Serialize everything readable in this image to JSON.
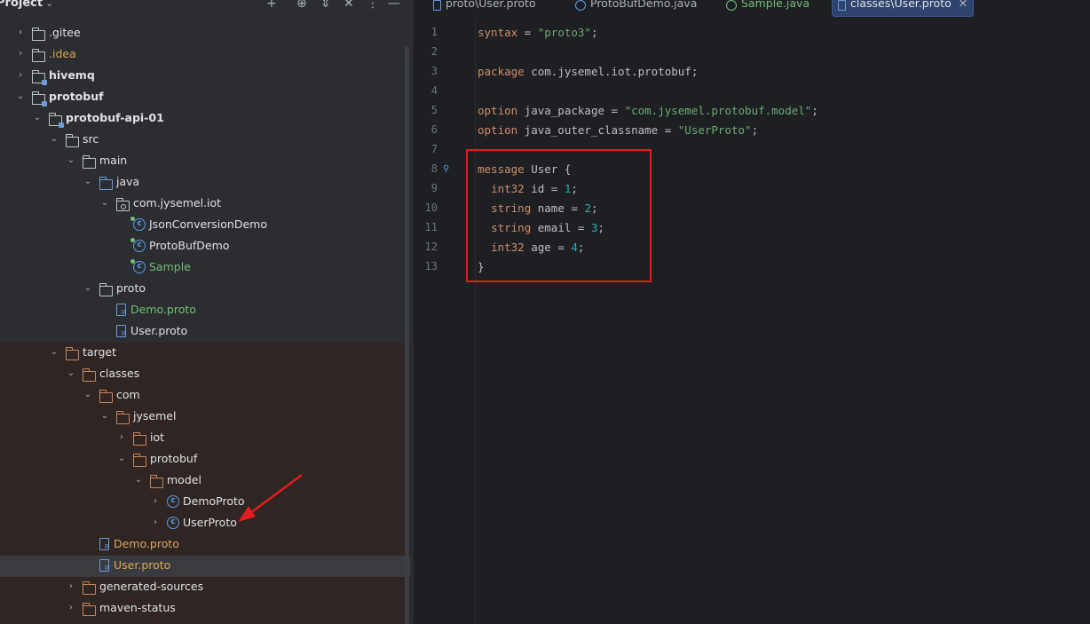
{
  "project_panel": {
    "title": "Project",
    "tree": [
      {
        "label": ".gitee",
        "arrow": "›",
        "icon": "folder",
        "style": ""
      },
      {
        "label": ".idea",
        "arrow": "›",
        "icon": "folder",
        "style": "orange"
      },
      {
        "label": "hivemq",
        "arrow": "›",
        "icon": "module-folder",
        "style": "bold"
      },
      {
        "label": "protobuf",
        "arrow": "⌄",
        "icon": "module-folder",
        "style": "bold"
      },
      {
        "label": "protobuf-api-01",
        "arrow": "⌄",
        "icon": "module-folder",
        "style": "bold"
      },
      {
        "label": "src",
        "arrow": "⌄",
        "icon": "folder",
        "style": ""
      },
      {
        "label": "main",
        "arrow": "⌄",
        "icon": "folder",
        "style": ""
      },
      {
        "label": "java",
        "arrow": "⌄",
        "icon": "folder-blue",
        "style": ""
      },
      {
        "label": "com.jysemel.iot",
        "arrow": "⌄",
        "icon": "package",
        "style": ""
      },
      {
        "label": "JsonConversionDemo",
        "arrow": "",
        "icon": "class-run",
        "style": ""
      },
      {
        "label": "ProtoBufDemo",
        "arrow": "",
        "icon": "class-run",
        "style": ""
      },
      {
        "label": "Sample",
        "arrow": "",
        "icon": "class-run",
        "style": "green"
      },
      {
        "label": "proto",
        "arrow": "⌄",
        "icon": "folder",
        "style": ""
      },
      {
        "label": "Demo.proto",
        "arrow": "",
        "icon": "proto-file",
        "style": "green"
      },
      {
        "label": "User.proto",
        "arrow": "",
        "icon": "proto-file",
        "style": ""
      },
      {
        "label": "target",
        "arrow": "⌄",
        "icon": "folder-orange",
        "style": ""
      },
      {
        "label": "classes",
        "arrow": "⌄",
        "icon": "folder-orange",
        "style": ""
      },
      {
        "label": "com",
        "arrow": "⌄",
        "icon": "folder-orange",
        "style": ""
      },
      {
        "label": "jysemel",
        "arrow": "⌄",
        "icon": "folder-orange",
        "style": ""
      },
      {
        "label": "iot",
        "arrow": "›",
        "icon": "folder-orange",
        "style": ""
      },
      {
        "label": "protobuf",
        "arrow": "⌄",
        "icon": "folder-orange",
        "style": ""
      },
      {
        "label": "model",
        "arrow": "⌄",
        "icon": "folder-orange",
        "style": ""
      },
      {
        "label": "DemoProto",
        "arrow": "›",
        "icon": "class",
        "style": ""
      },
      {
        "label": "UserProto",
        "arrow": "›",
        "icon": "class",
        "style": ""
      },
      {
        "label": "Demo.proto",
        "arrow": "",
        "icon": "proto-file",
        "style": "orange"
      },
      {
        "label": "User.proto",
        "arrow": "",
        "icon": "proto-file",
        "style": "orange"
      },
      {
        "label": "generated-sources",
        "arrow": "›",
        "icon": "folder-orange",
        "style": ""
      },
      {
        "label": "maven-status",
        "arrow": "›",
        "icon": "folder-orange",
        "style": ""
      }
    ]
  },
  "tabs": [
    {
      "label": "proto\\User.proto",
      "icon": "proto-file"
    },
    {
      "label": "ProtoBufDemo.java",
      "icon": "class"
    },
    {
      "label": "Sample.java",
      "icon": "class-green"
    },
    {
      "label": "classes\\User.proto",
      "icon": "proto-file",
      "active": true
    }
  ],
  "editor": {
    "line_numbers": [
      "1",
      "2",
      "3",
      "4",
      "5",
      "6",
      "7",
      "8",
      "9",
      "10",
      "11",
      "12",
      "13"
    ]
  },
  "colors": {
    "keyword": "#cf8e6d",
    "string": "#6aab73",
    "number": "#2aacb8",
    "highlight": "#e11d1d"
  }
}
